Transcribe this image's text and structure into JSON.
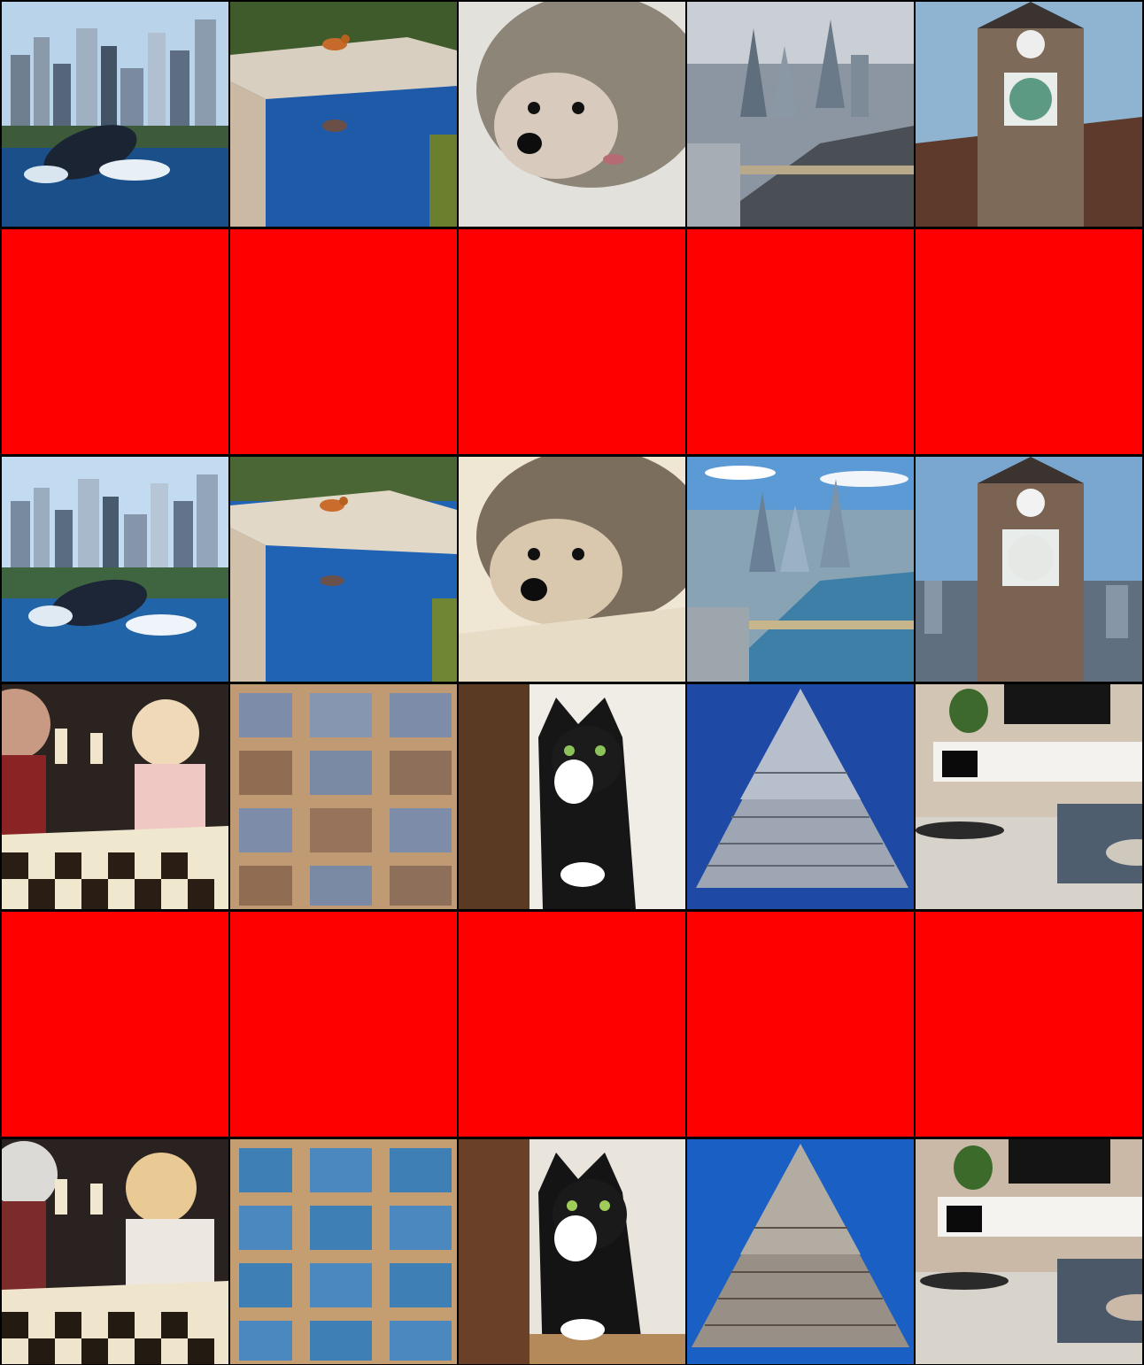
{
  "grid": {
    "columns": 5,
    "rows": 6,
    "mask_color": "#ff0000",
    "background": "#000000"
  },
  "tiles": [
    {
      "row": 1,
      "col": 1,
      "subject": "whale-breaching-city-skyline",
      "style": "photo"
    },
    {
      "row": 1,
      "col": 2,
      "subject": "bird-on-pool-ledge",
      "style": "photo"
    },
    {
      "row": 1,
      "col": 3,
      "subject": "hedgehog-closeup",
      "style": "photo"
    },
    {
      "row": 1,
      "col": 4,
      "subject": "london-aerial-river",
      "style": "photo"
    },
    {
      "row": 1,
      "col": 5,
      "subject": "gothic-clock-tower",
      "style": "photo"
    },
    {
      "row": 2,
      "col": 1,
      "subject": "masked",
      "style": "blank"
    },
    {
      "row": 2,
      "col": 2,
      "subject": "masked",
      "style": "blank"
    },
    {
      "row": 2,
      "col": 3,
      "subject": "masked",
      "style": "blank"
    },
    {
      "row": 2,
      "col": 4,
      "subject": "masked",
      "style": "blank"
    },
    {
      "row": 2,
      "col": 5,
      "subject": "masked",
      "style": "blank"
    },
    {
      "row": 3,
      "col": 1,
      "subject": "whale-breaching-city-skyline",
      "style": "painted"
    },
    {
      "row": 3,
      "col": 2,
      "subject": "bird-on-pool-ledge",
      "style": "painted"
    },
    {
      "row": 3,
      "col": 3,
      "subject": "hedgehog-closeup",
      "style": "painted"
    },
    {
      "row": 3,
      "col": 4,
      "subject": "london-aerial-river",
      "style": "painted"
    },
    {
      "row": 3,
      "col": 5,
      "subject": "gothic-clock-tower",
      "style": "painted"
    },
    {
      "row": 4,
      "col": 1,
      "subject": "chess-players",
      "style": "photo"
    },
    {
      "row": 4,
      "col": 2,
      "subject": "bookshelves",
      "style": "photo"
    },
    {
      "row": 4,
      "col": 3,
      "subject": "tuxedo-cat-window",
      "style": "photo"
    },
    {
      "row": 4,
      "col": 4,
      "subject": "stacked-pyramid",
      "style": "photo"
    },
    {
      "row": 4,
      "col": 5,
      "subject": "living-room",
      "style": "photo"
    },
    {
      "row": 5,
      "col": 1,
      "subject": "masked",
      "style": "blank"
    },
    {
      "row": 5,
      "col": 2,
      "subject": "masked",
      "style": "blank"
    },
    {
      "row": 5,
      "col": 3,
      "subject": "masked",
      "style": "blank"
    },
    {
      "row": 5,
      "col": 4,
      "subject": "masked",
      "style": "blank"
    },
    {
      "row": 5,
      "col": 5,
      "subject": "masked",
      "style": "blank"
    },
    {
      "row": 6,
      "col": 1,
      "subject": "chess-players",
      "style": "painted"
    },
    {
      "row": 6,
      "col": 2,
      "subject": "bookshelves",
      "style": "painted"
    },
    {
      "row": 6,
      "col": 3,
      "subject": "tuxedo-cat-window",
      "style": "painted"
    },
    {
      "row": 6,
      "col": 4,
      "subject": "stacked-pyramid",
      "style": "painted"
    },
    {
      "row": 6,
      "col": 5,
      "subject": "living-room",
      "style": "painted"
    }
  ]
}
